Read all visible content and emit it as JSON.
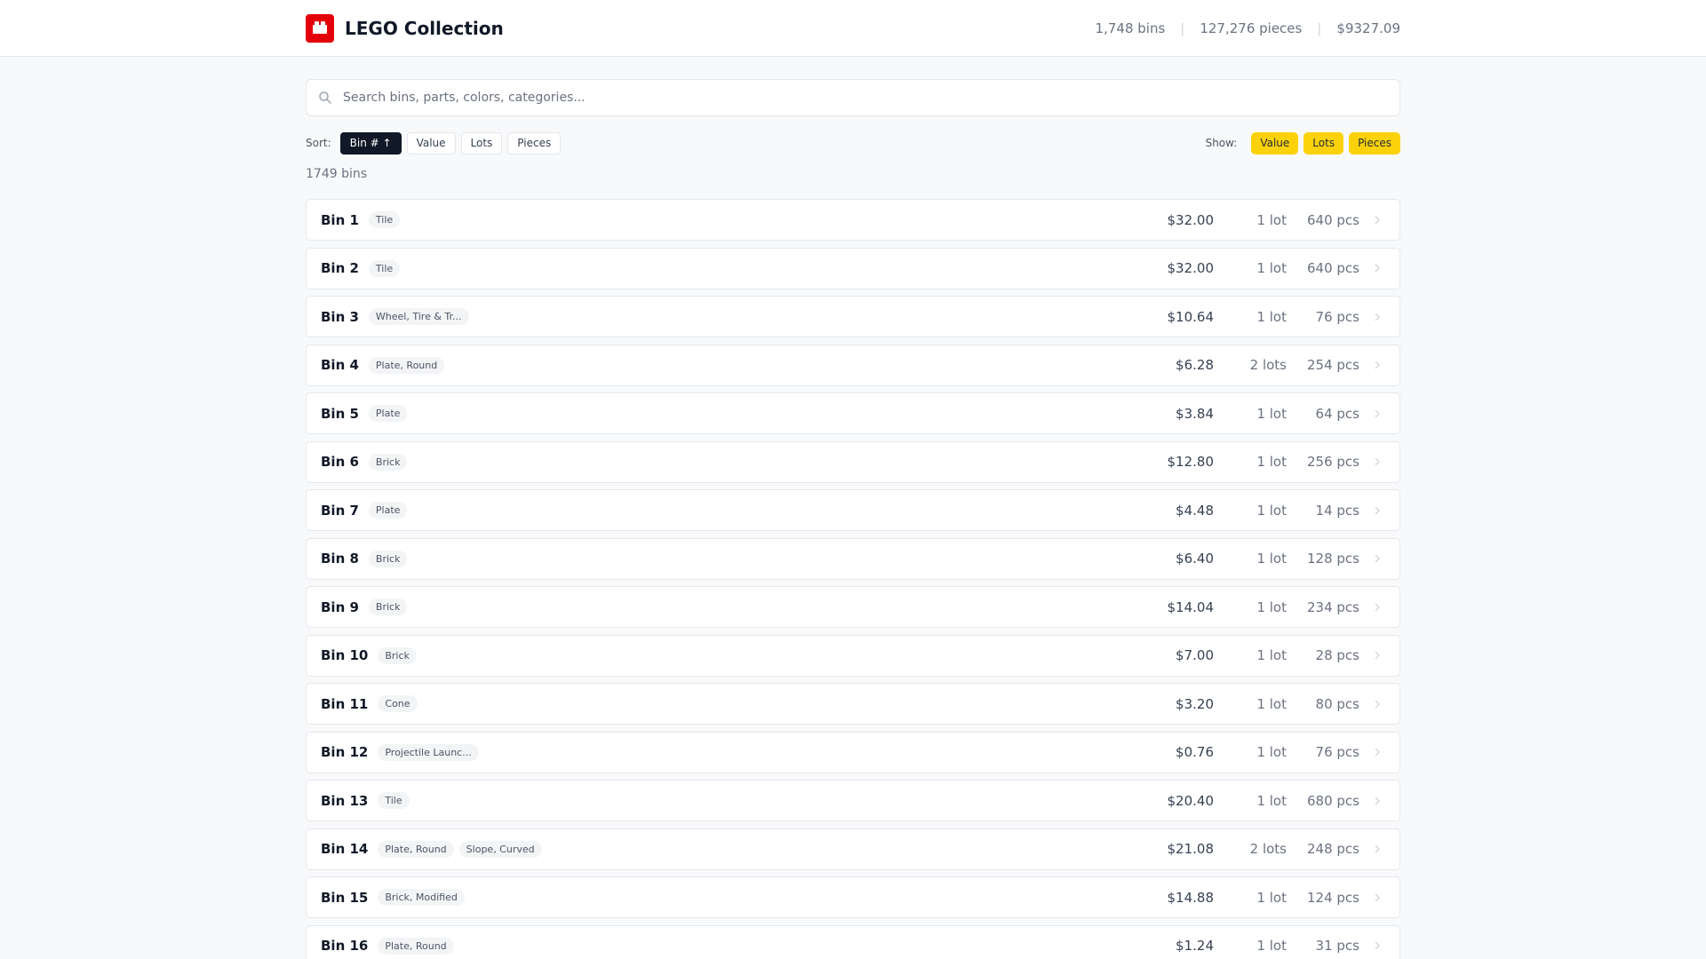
{
  "header": {
    "title": "LEGO Collection",
    "stats": {
      "bins": "1,748 bins",
      "pieces": "127,276 pieces",
      "value": "$9327.09"
    },
    "separator": "|"
  },
  "search": {
    "placeholder": "Search bins, parts, colors, categories..."
  },
  "sort": {
    "label": "Sort:",
    "options": [
      "Bin # ↑",
      "Value",
      "Lots",
      "Pieces"
    ],
    "active": "Bin # ↑"
  },
  "show": {
    "label": "Show:",
    "options": [
      "Value",
      "Lots",
      "Pieces"
    ]
  },
  "count": "1749 bins",
  "colors": {
    "brand": "#e3000b",
    "accent": "#fbd20a",
    "active_sort": "#111827"
  },
  "icons": {
    "logo": "lego-brick-icon",
    "search": "search-icon",
    "row": "chevron-right-icon"
  },
  "bins": [
    {
      "name": "Bin 1",
      "tags": [
        "Tile"
      ],
      "value": "$32.00",
      "lots": "1 lot",
      "pieces": "640 pcs"
    },
    {
      "name": "Bin 2",
      "tags": [
        "Tile"
      ],
      "value": "$32.00",
      "lots": "1 lot",
      "pieces": "640 pcs"
    },
    {
      "name": "Bin 3",
      "tags": [
        "Wheel, Tire & Tr..."
      ],
      "value": "$10.64",
      "lots": "1 lot",
      "pieces": "76 pcs"
    },
    {
      "name": "Bin 4",
      "tags": [
        "Plate, Round"
      ],
      "value": "$6.28",
      "lots": "2 lots",
      "pieces": "254 pcs"
    },
    {
      "name": "Bin 5",
      "tags": [
        "Plate"
      ],
      "value": "$3.84",
      "lots": "1 lot",
      "pieces": "64 pcs"
    },
    {
      "name": "Bin 6",
      "tags": [
        "Brick"
      ],
      "value": "$12.80",
      "lots": "1 lot",
      "pieces": "256 pcs"
    },
    {
      "name": "Bin 7",
      "tags": [
        "Plate"
      ],
      "value": "$4.48",
      "lots": "1 lot",
      "pieces": "14 pcs"
    },
    {
      "name": "Bin 8",
      "tags": [
        "Brick"
      ],
      "value": "$6.40",
      "lots": "1 lot",
      "pieces": "128 pcs"
    },
    {
      "name": "Bin 9",
      "tags": [
        "Brick"
      ],
      "value": "$14.04",
      "lots": "1 lot",
      "pieces": "234 pcs"
    },
    {
      "name": "Bin 10",
      "tags": [
        "Brick"
      ],
      "value": "$7.00",
      "lots": "1 lot",
      "pieces": "28 pcs"
    },
    {
      "name": "Bin 11",
      "tags": [
        "Cone"
      ],
      "value": "$3.20",
      "lots": "1 lot",
      "pieces": "80 pcs"
    },
    {
      "name": "Bin 12",
      "tags": [
        "Projectile Launc..."
      ],
      "value": "$0.76",
      "lots": "1 lot",
      "pieces": "76 pcs"
    },
    {
      "name": "Bin 13",
      "tags": [
        "Tile"
      ],
      "value": "$20.40",
      "lots": "1 lot",
      "pieces": "680 pcs"
    },
    {
      "name": "Bin 14",
      "tags": [
        "Plate, Round",
        "Slope, Curved"
      ],
      "value": "$21.08",
      "lots": "2 lots",
      "pieces": "248 pcs"
    },
    {
      "name": "Bin 15",
      "tags": [
        "Brick, Modified"
      ],
      "value": "$14.88",
      "lots": "1 lot",
      "pieces": "124 pcs"
    },
    {
      "name": "Bin 16",
      "tags": [
        "Plate, Round"
      ],
      "value": "$1.24",
      "lots": "1 lot",
      "pieces": "31 pcs"
    }
  ]
}
